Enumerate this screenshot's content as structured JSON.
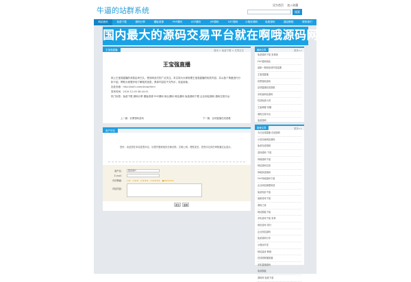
{
  "header": {
    "title": "牛逼的站群系统",
    "links": [
      "设为首页",
      "加入收藏"
    ],
    "search_button": "搜索"
  },
  "nav": {
    "items": [
      "网站首页",
      "免费下载",
      "源码分享",
      "模板资源",
      "PHP源码",
      "ASP源码",
      "JSP源码",
      "NET源码",
      "小程序源码",
      "免费源码",
      "建站教程",
      "联系我们"
    ]
  },
  "banner": {
    "text": "国内最大的源码交易平台就在啊哦源码网"
  },
  "article": {
    "tab_label": "王宝强直播",
    "breadcrumb": "首页 > 免费下载 > 文章正文",
    "title": "王宝强直播",
    "paragraphs": [
      "网上王宝强直播的消息由来已久，受到网友们的广泛关注。本文将为大家梳理王宝强直播的相关内容，并从各个角度进行分析介绍，帮助大家更好地了解相关信息，具体内容如下文所示，欢迎阅读。",
      "出处页面：http://koifu.com/show/html",
      "发布时间：2019-12-05 08:44:41",
      "热门标签：免费下载 源码分享 模板资源 PHP源码 商业源码 网站源码 免费源码下载 企业网站源码 源码交易平台"
    ],
    "prev": "上一篇：彩票源码游戏",
    "next": "下一篇：足球直播在线观看"
  },
  "comments": {
    "tab_label": "用户评论",
    "notice": "您好，欢迎您在本站发表评论，请遵守国家相关法律法规，文明上网，理性发言，您的评论将在审核通过后显示。",
    "name_label": "用户名：",
    "name_value": "匿名用户",
    "email_label": "E-mail：",
    "rating_label": "评分等级：",
    "rating_options": [
      "★",
      "★★",
      "★★★",
      "★★★★",
      "★★★★★"
    ],
    "content_label": "评论内容：",
    "submit": "提交",
    "reset": "重置"
  },
  "sidebar_top": {
    "title": "最新文章",
    "more": "更多>>",
    "items": [
      "免费源码下载 安卓版",
      "PHP源码网站",
      "最新一期双色球开奖结果",
      "王宝强直播",
      "彩票源码游戏",
      "足球直播在线观看",
      "手机版网站源码",
      "在线免费小说",
      "王者荣耀 攻略",
      "源码交易平台",
      "免费源码",
      "企业网站源码下载",
      "小程序源码免费下载"
    ]
  },
  "sidebar_bottom": {
    "title": "推荐文章",
    "more": "更多>>",
    "items": [
      "今日足球直播 在线观看",
      "小说阅读网站源码",
      "免费在线视频",
      "游戏源码 下载",
      "商城源码下载",
      "网站源码交易",
      "商城系统源码",
      "PHP商城源码下载",
      "企业网站管理系统",
      "免费电影下载",
      "最新游戏下载",
      "源码之家",
      "网站模板下载",
      "手机游戏下载 安卓",
      "网页游戏 排行",
      "企业网站源码",
      "免费源码分享",
      "小程序开发",
      "网站建设 教程",
      "在线视频播放器",
      "手机直播源码",
      "免费模板",
      "源码网 免费下载"
    ]
  },
  "colors": {
    "accent": "#1e9ee0",
    "banner": "#1aa2e5",
    "page_bg": "#e5e8ec",
    "star": "#e6a100"
  }
}
